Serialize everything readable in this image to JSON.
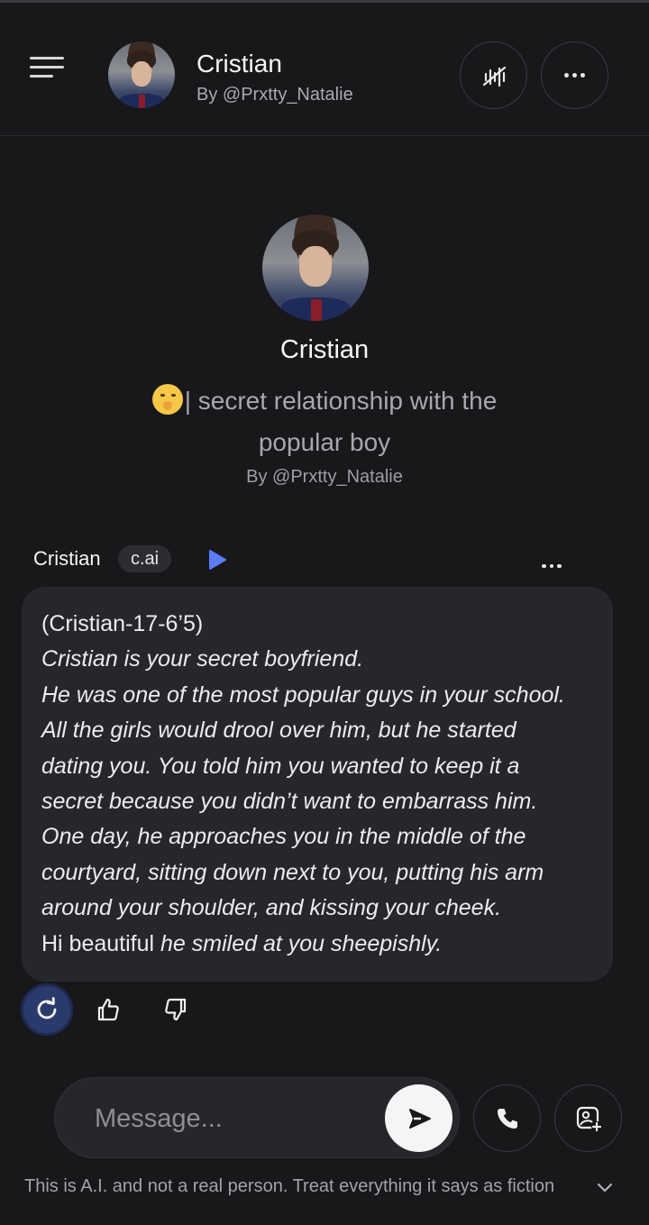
{
  "header": {
    "character_name": "Cristian",
    "creator": "By @Prxtty_Natalie"
  },
  "profile": {
    "name": "Cristian",
    "description": "| secret relationship with the popular boy",
    "creator": "By @Prxtty_Natalie"
  },
  "message": {
    "sender": "Cristian",
    "tag": "c.ai",
    "lines": [
      {
        "text": "(Cristian-17-6’5)",
        "italic": false
      },
      {
        "text": "Cristian is your secret boyfriend.",
        "italic": true
      },
      {
        "text": "He was one of the most popular guys in your school.",
        "italic": true
      },
      {
        "text": "All the girls would drool over him, but he started",
        "italic": true
      },
      {
        "text": "dating you. You told him you wanted to keep it a",
        "italic": true
      },
      {
        "text": "secret because you didn’t want to embarrass him.",
        "italic": true
      },
      {
        "text": "One day, he approaches you in the middle of the",
        "italic": true
      },
      {
        "text": "courtyard, sitting down next to you, putting his arm",
        "italic": true
      },
      {
        "text": "around your shoulder, and kissing your cheek.",
        "italic": true
      }
    ],
    "last_line_plain": "Hi beautiful ",
    "last_line_italic": "he smiled at you sheepishly."
  },
  "composer": {
    "placeholder": "Message..."
  },
  "footer": {
    "disclaimer": "This is A.I. and not a real person. Treat everything it says as fiction"
  },
  "icons": {
    "menu": "hamburger-menu-icon",
    "voice": "voice-waveform-off-icon",
    "more": "ellipsis-icon",
    "play": "play-icon",
    "regenerate": "refresh-icon",
    "like": "thumbs-up-icon",
    "dislike": "thumbs-down-icon",
    "send": "send-arrow-icon",
    "call": "phone-icon",
    "image": "add-image-icon",
    "expand": "chevron-down-icon"
  },
  "colors": {
    "background": "#18181b",
    "bubble": "#26272b",
    "accent": "#5b7cf7",
    "regen_active": "#2a3a6a"
  }
}
